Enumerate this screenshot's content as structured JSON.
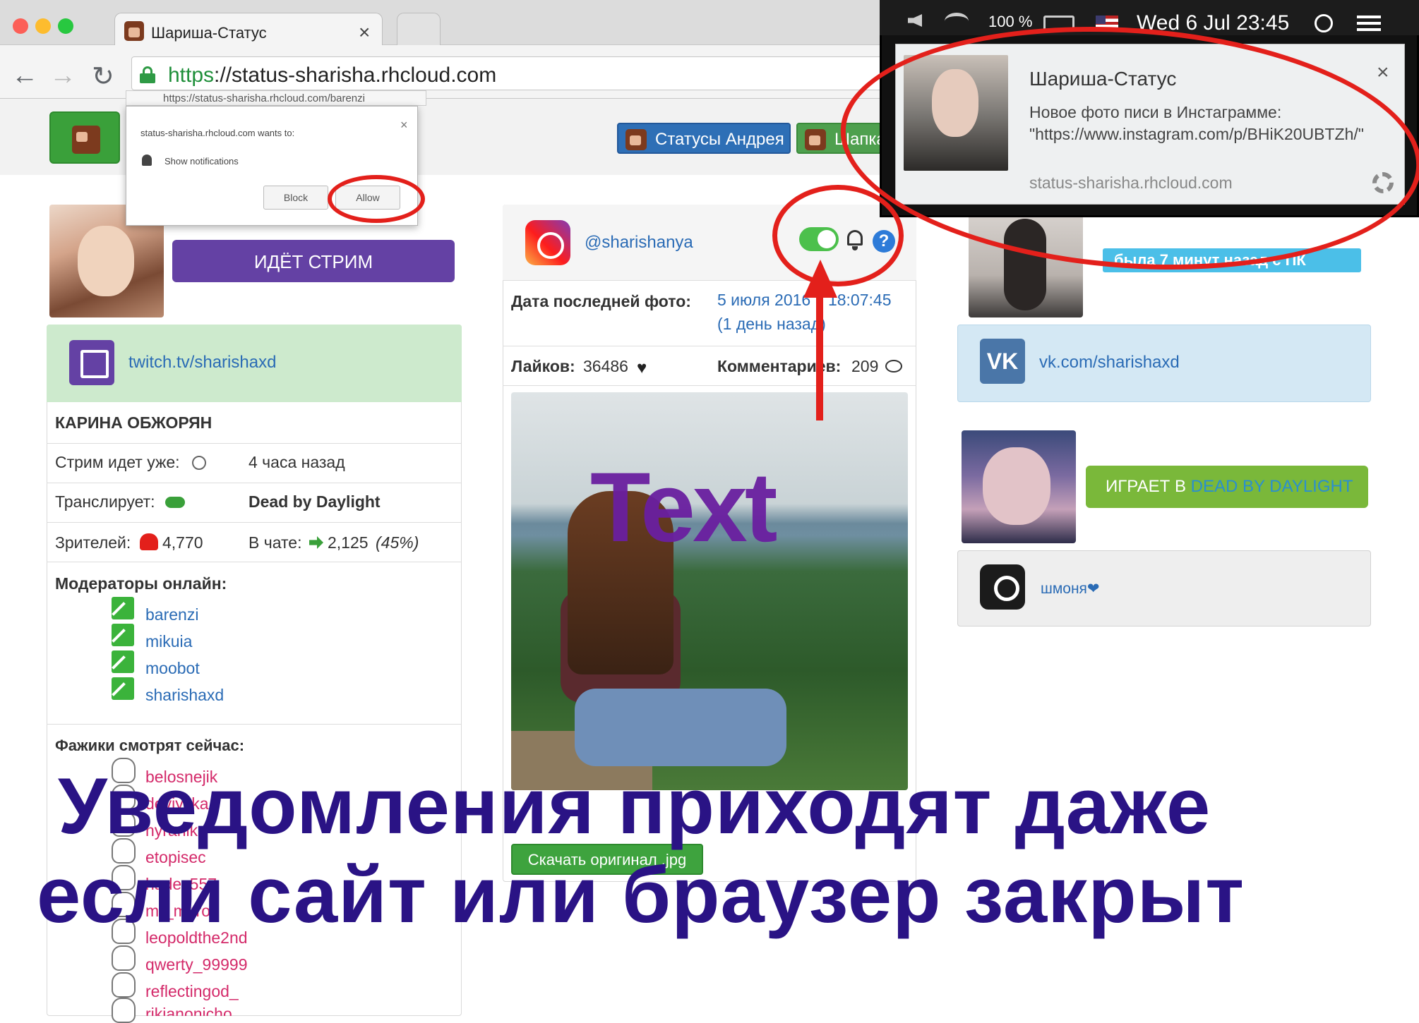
{
  "browser": {
    "tab_title": "Шариша-Статус",
    "tab_close": "×",
    "url_scheme": "https",
    "url_rest": "://status-sharisha.rhcloud.com"
  },
  "header": {
    "btn_andrey": "Статусы Андрея",
    "btn_shapka": "Шапка"
  },
  "permission_popup": {
    "url": "https://status-sharisha.rhcloud.com/barenzi",
    "title": "status-sharisha.rhcloud.com wants to:",
    "message": "Show notifications",
    "block": "Block",
    "allow": "Allow",
    "close": "×"
  },
  "twitch": {
    "stream_button": "ИДЁТ СТРИМ",
    "link": "twitch.tv/sharishaxd",
    "streamer": "КАРИНА ОБЖОРЯН",
    "rows": [
      {
        "label": "Стрим идет уже:",
        "value": "4 часа назад"
      },
      {
        "label": "Транслирует:",
        "value": "Dead by Daylight"
      },
      {
        "label": "Зрителей:",
        "value": "4,770",
        "chat_label": "В чате:",
        "chat_value": "2,125",
        "chat_pct": "(45%)"
      }
    ],
    "mods_title": "Модераторы онлайн:",
    "mods": [
      "barenzi",
      "mikuia",
      "moobot",
      "sharishaxd"
    ],
    "fans_title": "Фажики смотрят сейчас:",
    "fans": [
      "belosnejik",
      "deviyska",
      "hyranika",
      "etopisec",
      "hades557",
      "mr_mirror",
      "leopoldthe2nd",
      "qwerty_99999",
      "reflectingod_",
      "rikianonicho"
    ]
  },
  "instagram": {
    "link": "@sharishanya",
    "last_photo_label": "Дата последней фото:",
    "last_photo_value": "5 июля 2016 г. 18:07:45",
    "last_photo_ago": "(1 день назад)",
    "likes_label": "Лайков:",
    "likes_value": "36486",
    "comments_label": "Комментариев:",
    "comments_value": "209",
    "overlay_text": "Text",
    "download": "Скачать оригинал .jpg",
    "help": "?"
  },
  "right": {
    "pc_status": "была 7 минут назад с ПК",
    "vk_link": "vk.com/sharishaxd",
    "vk_logo": "VK",
    "game_prefix": "ИГРАЕТ В ",
    "game_name": "DEAD BY DAYLIGHT",
    "steam_name": "шмоня❤"
  },
  "menubar": {
    "battery": "100 %",
    "clock": "Wed 6 Jul  23:45"
  },
  "notification": {
    "title": "Шариша-Статус",
    "body": "Новое фото писи в Инстаграмме: \"https://www.instagram.com/p/BHiK20UBTZh/\"",
    "site": "status-sharisha.rhcloud.com",
    "close": "×"
  },
  "caption": {
    "line1": "Уведомления приходят даже",
    "line2": "если сайт или браузер закрыт"
  },
  "colors": {
    "twitch": "#6441a4",
    "accent_red": "#e3201b",
    "caption": "#2a1385",
    "link": "#2a6bb5"
  }
}
